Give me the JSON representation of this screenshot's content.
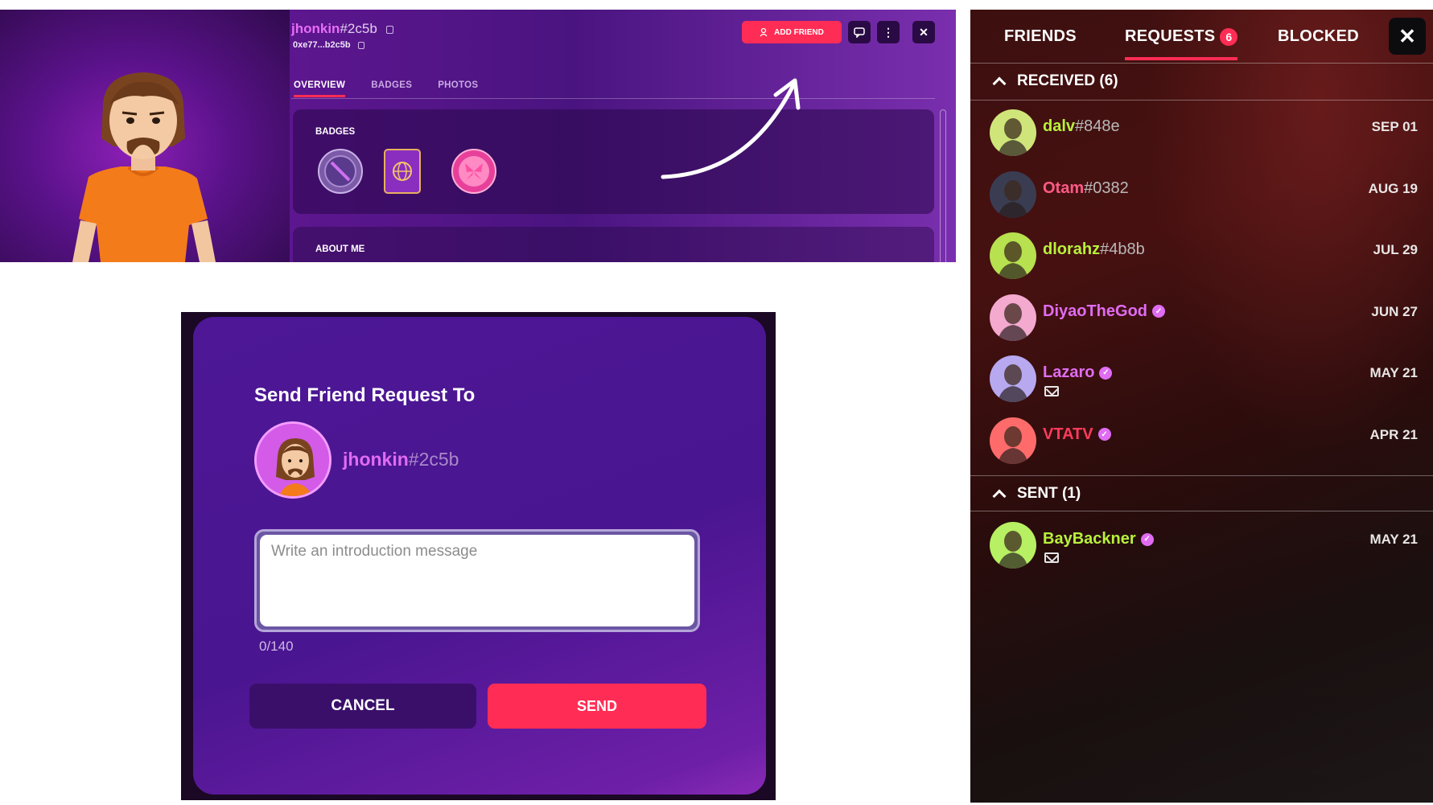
{
  "profile": {
    "username": "jhonkin",
    "tag": "#2c5b",
    "address": "0xe77...b2c5b",
    "tabs": [
      "OVERVIEW",
      "BADGES",
      "PHOTOS"
    ],
    "badges_label": "BADGES",
    "about_label": "ABOUT ME",
    "add_friend_label": "ADD FRIEND"
  },
  "modal": {
    "title": "Send Friend Request To",
    "username": "jhonkin",
    "tag": "#2c5b",
    "message_placeholder": "Write an introduction message",
    "message_value": "",
    "counter": "0/140",
    "cancel_label": "CANCEL",
    "send_label": "SEND"
  },
  "friends_panel": {
    "tabs": {
      "friends": "FRIENDS",
      "requests": "REQUESTS",
      "blocked": "BLOCKED"
    },
    "requests_count": "6",
    "received_header": "RECEIVED (6)",
    "sent_header": "SENT (1)",
    "received": [
      {
        "name": "dalv",
        "tag": "#848e",
        "date": "SEP 01",
        "name_color": "#b7f23c",
        "avatar_bg": "#cfe57a"
      },
      {
        "name": "Otam",
        "tag": "#0382",
        "date": "AUG 19",
        "name_color": "#ff5a86",
        "avatar_bg": "#3a3d52"
      },
      {
        "name": "dlorahz",
        "tag": "#4b8b",
        "date": "JUL 29",
        "name_color": "#b7f23c",
        "avatar_bg": "#b7e14e"
      },
      {
        "name": "DiyaoTheGod",
        "tag": "",
        "date": "JUN 27",
        "name_color": "#e06cf2",
        "avatar_bg": "#f4a9cf"
      },
      {
        "name": "Lazaro",
        "tag": "",
        "date": "MAY 21",
        "name_color": "#e06cf2",
        "avatar_bg": "#b7a8f0"
      },
      {
        "name": "VTATV",
        "tag": "",
        "date": "APR 21",
        "name_color": "#ff3b5c",
        "avatar_bg": "#ff6b6b"
      }
    ],
    "sent": [
      {
        "name": "BayBackner",
        "tag": "",
        "date": "MAY 21",
        "name_color": "#b7f23c",
        "avatar_bg": "#b7f062"
      }
    ]
  }
}
